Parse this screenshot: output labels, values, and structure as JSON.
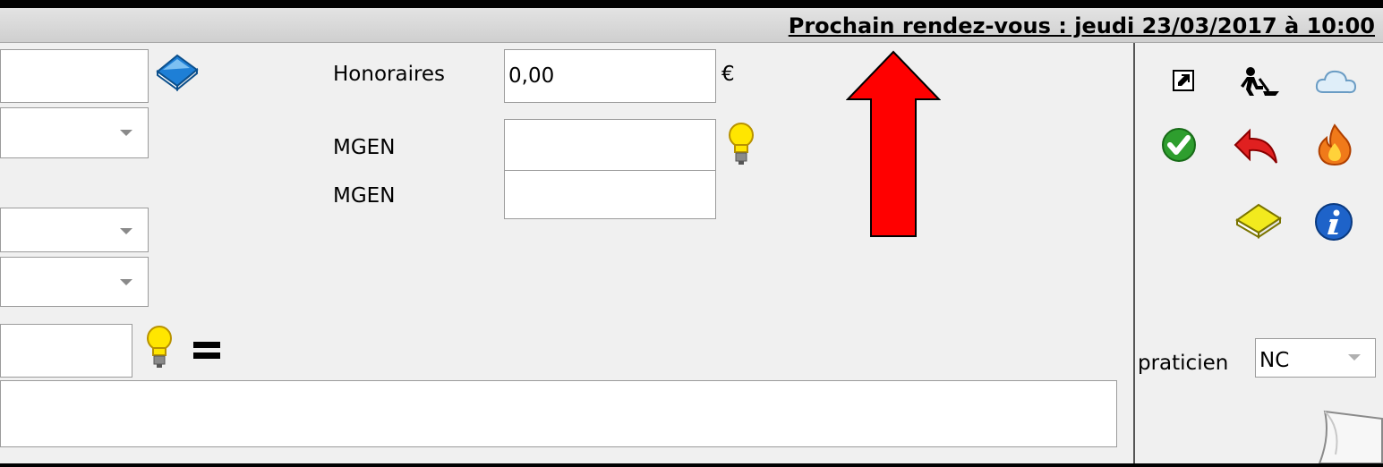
{
  "header": {
    "next_appointment": "Prochain rendez-vous : jeudi 23/03/2017 à 10:00"
  },
  "form": {
    "honoraires_label": "Honoraires",
    "honoraires_value": "0,00",
    "currency": "€",
    "mgen_label_1": "MGEN",
    "mgen_label_2": "MGEN"
  },
  "sidebar": {
    "praticien_label": "praticien",
    "praticien_value": "NC"
  },
  "icons": [
    "book-blue-icon",
    "lightbulb-icon",
    "equals-icon",
    "external-link-icon",
    "person-shovel-icon",
    "cloud-icon",
    "check-icon",
    "undo-icon",
    "fire-icon",
    "book-yellow-icon",
    "info-icon",
    "paper-corner-icon"
  ],
  "colors": {
    "accent_arrow": "#ff0000",
    "panel_bg": "#f0f0f0",
    "header_bg": "#d8d8d8"
  }
}
